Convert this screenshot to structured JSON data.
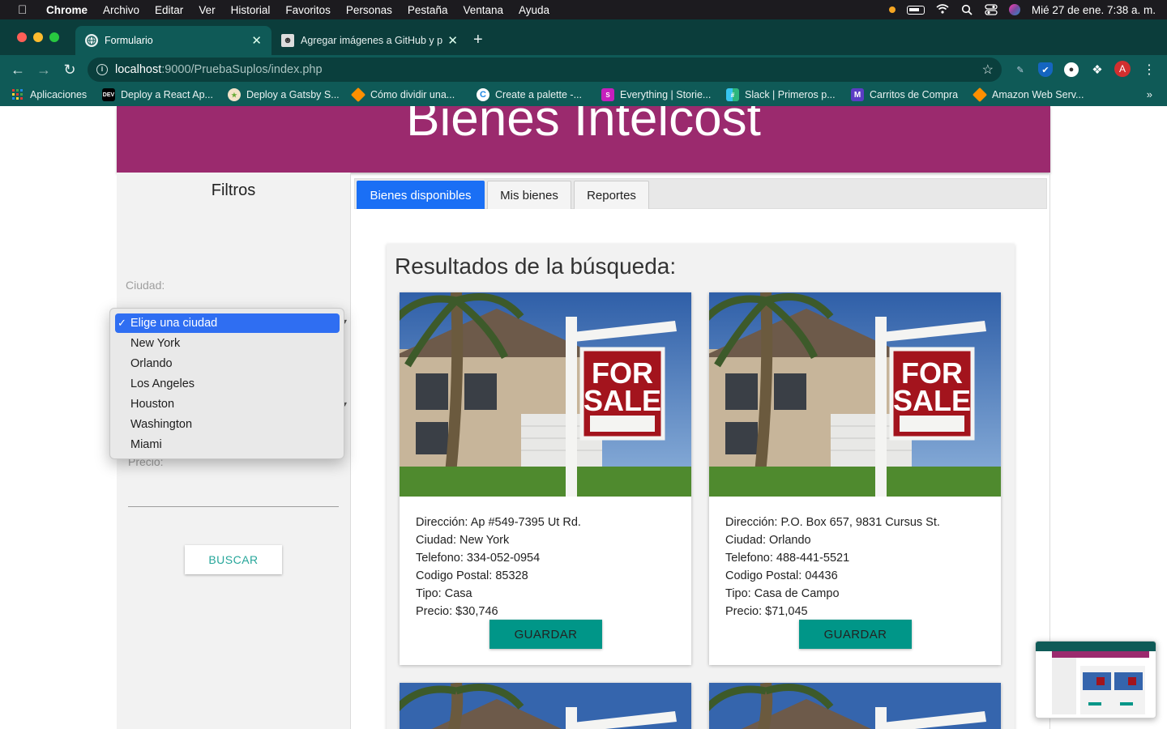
{
  "menubar": {
    "app": "Chrome",
    "items": [
      "Archivo",
      "Editar",
      "Ver",
      "Historial",
      "Favoritos",
      "Personas",
      "Pestaña",
      "Ventana",
      "Ayuda"
    ],
    "clock": "Mié 27 de ene.  7:38 a. m."
  },
  "tabs": [
    {
      "title": "Formulario",
      "icon": "globe-icon"
    },
    {
      "title": "Agregar imágenes a GitHub y p",
      "icon": "avatar-icon"
    }
  ],
  "toolbar": {
    "url_host": "localhost",
    "url_rest": ":9000/PruebaSuplos/index.php",
    "profile_initial": "A"
  },
  "bookmarks": [
    {
      "label": "Aplicaciones",
      "icon": "apps-grid-icon"
    },
    {
      "label": "Deploy a React Ap...",
      "icon": "dev-icon"
    },
    {
      "label": "Deploy a Gatsby S...",
      "icon": "gatsby-icon"
    },
    {
      "label": "Cómo dividir una...",
      "icon": "aws-cube-icon"
    },
    {
      "label": "Create a palette -...",
      "icon": "palette-icon"
    },
    {
      "label": "Everything | Storie...",
      "icon": "storybook-icon"
    },
    {
      "label": "Slack | Primeros p...",
      "icon": "slack-icon"
    },
    {
      "label": "Carritos de Compra",
      "icon": "m-icon"
    },
    {
      "label": "Amazon Web Serv...",
      "icon": "aws-cube-icon"
    }
  ],
  "page": {
    "header_title": "Bienes Intelcost",
    "filters": {
      "title": "Filtros",
      "city_label": "Ciudad:",
      "price_label": "Precio:",
      "search_button": "BUSCAR",
      "city_options": [
        "Elige una ciudad",
        "New York",
        "Orlando",
        "Los Angeles",
        "Houston",
        "Washington",
        "Miami"
      ],
      "city_selected": "Elige una ciudad"
    },
    "nav_tabs": [
      "Bienes disponibles",
      "Mis bienes",
      "Reportes"
    ],
    "results_title": "Resultados de la búsqueda:",
    "photo_sign_line1": "FOR",
    "photo_sign_line2": "SALE",
    "cards": [
      {
        "direccion": "Dirección: Ap #549-7395 Ut Rd.",
        "ciudad": "Ciudad: New York",
        "telefono": "Telefono: 334-052-0954",
        "codigo": "Codigo Postal: 85328",
        "tipo": "Tipo: Casa",
        "precio": "Precio: $30,746",
        "button": "GUARDAR"
      },
      {
        "direccion": "Dirección: P.O. Box 657, 9831 Cursus St.",
        "ciudad": "Ciudad: Orlando",
        "telefono": "Telefono: 488-441-5521",
        "codigo": "Codigo Postal: 04436",
        "tipo": "Tipo: Casa de Campo",
        "precio": "Precio: $71,045",
        "button": "GUARDAR"
      }
    ]
  },
  "colors": {
    "header": "#9b2a6e",
    "tab_active": "#1a6ff5",
    "button_teal": "#009688",
    "chrome_frame": "#0b3d3b"
  }
}
